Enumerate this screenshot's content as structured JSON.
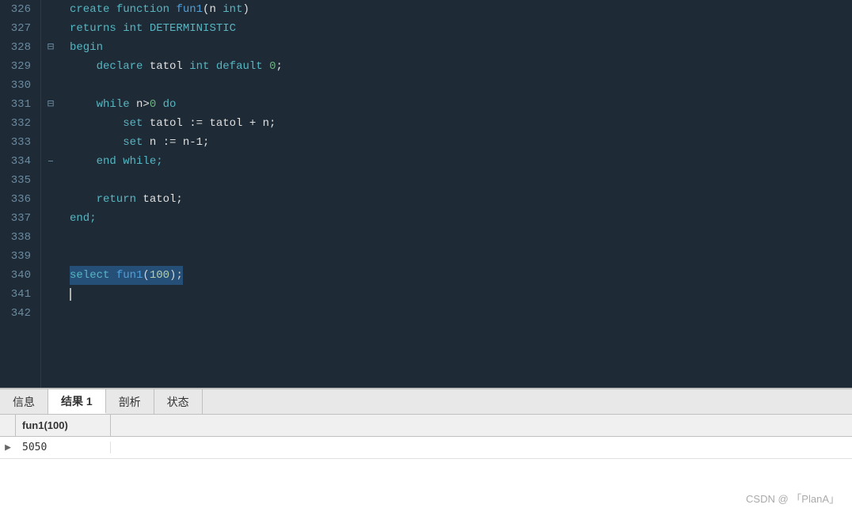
{
  "editor": {
    "lines": [
      {
        "num": "326",
        "tokens": [
          {
            "text": "create ",
            "cls": "c-cyan"
          },
          {
            "text": "function ",
            "cls": "c-cyan"
          },
          {
            "text": "fun1",
            "cls": "c-blue"
          },
          {
            "text": "(n ",
            "cls": "c-white"
          },
          {
            "text": "int",
            "cls": "c-cyan"
          },
          {
            "text": ")",
            "cls": "c-white"
          }
        ],
        "fold": false,
        "foldOpen": false
      },
      {
        "num": "327",
        "tokens": [
          {
            "text": "returns ",
            "cls": "c-cyan"
          },
          {
            "text": "int ",
            "cls": "c-cyan"
          },
          {
            "text": "DETERMINISTIC",
            "cls": "c-cyan"
          }
        ],
        "fold": false,
        "foldOpen": false
      },
      {
        "num": "328",
        "tokens": [
          {
            "text": "begin",
            "cls": "c-cyan"
          }
        ],
        "fold": true,
        "foldOpen": true
      },
      {
        "num": "329",
        "tokens": [
          {
            "text": "    declare ",
            "cls": "c-cyan"
          },
          {
            "text": "tatol ",
            "cls": "c-white"
          },
          {
            "text": "int ",
            "cls": "c-cyan"
          },
          {
            "text": "default ",
            "cls": "c-cyan"
          },
          {
            "text": "0",
            "cls": "c-green-num"
          },
          {
            "text": ";",
            "cls": "c-white"
          }
        ],
        "fold": false,
        "foldOpen": false
      },
      {
        "num": "330",
        "tokens": [],
        "fold": false,
        "foldOpen": false
      },
      {
        "num": "331",
        "tokens": [
          {
            "text": "    while ",
            "cls": "c-cyan"
          },
          {
            "text": "n>",
            "cls": "c-white"
          },
          {
            "text": "0",
            "cls": "c-green-num"
          },
          {
            "text": " do",
            "cls": "c-cyan"
          }
        ],
        "fold": true,
        "foldOpen": true
      },
      {
        "num": "332",
        "tokens": [
          {
            "text": "        set ",
            "cls": "c-cyan"
          },
          {
            "text": "tatol := tatol + n;",
            "cls": "c-white"
          }
        ],
        "fold": false,
        "foldOpen": false
      },
      {
        "num": "333",
        "tokens": [
          {
            "text": "        set ",
            "cls": "c-cyan"
          },
          {
            "text": "n := n-1;",
            "cls": "c-white"
          }
        ],
        "fold": false,
        "foldOpen": false
      },
      {
        "num": "334",
        "tokens": [
          {
            "text": "    end ",
            "cls": "c-cyan"
          },
          {
            "text": "while;",
            "cls": "c-cyan"
          }
        ],
        "fold": false,
        "foldOpen": false
      },
      {
        "num": "335",
        "tokens": [],
        "fold": false,
        "foldOpen": false
      },
      {
        "num": "336",
        "tokens": [
          {
            "text": "    return ",
            "cls": "c-cyan"
          },
          {
            "text": "tatol;",
            "cls": "c-white"
          }
        ],
        "fold": false,
        "foldOpen": false
      },
      {
        "num": "337",
        "tokens": [
          {
            "text": "end;",
            "cls": "c-cyan"
          }
        ],
        "fold": false,
        "foldOpen": false
      },
      {
        "num": "338",
        "tokens": [],
        "fold": false,
        "foldOpen": false
      },
      {
        "num": "339",
        "tokens": [],
        "fold": false,
        "foldOpen": false
      },
      {
        "num": "340",
        "tokens": [
          {
            "text": "select fun1(100);",
            "cls": "highlight-select"
          }
        ],
        "fold": false,
        "foldOpen": false,
        "highlighted": true
      },
      {
        "num": "341",
        "tokens": [],
        "fold": false,
        "foldOpen": false,
        "cursor": true
      },
      {
        "num": "342",
        "tokens": [],
        "fold": false,
        "foldOpen": false
      }
    ]
  },
  "bottomPanel": {
    "tabs": [
      {
        "label": "信息",
        "active": false
      },
      {
        "label": "结果 1",
        "active": true
      },
      {
        "label": "剖析",
        "active": false
      },
      {
        "label": "状态",
        "active": false
      }
    ],
    "resultTable": {
      "columns": [
        "fun1(100)"
      ],
      "rows": [
        {
          "indicator": "▶",
          "values": [
            "5050"
          ]
        }
      ]
    }
  },
  "watermark": "CSDN @ 「PlanA」"
}
